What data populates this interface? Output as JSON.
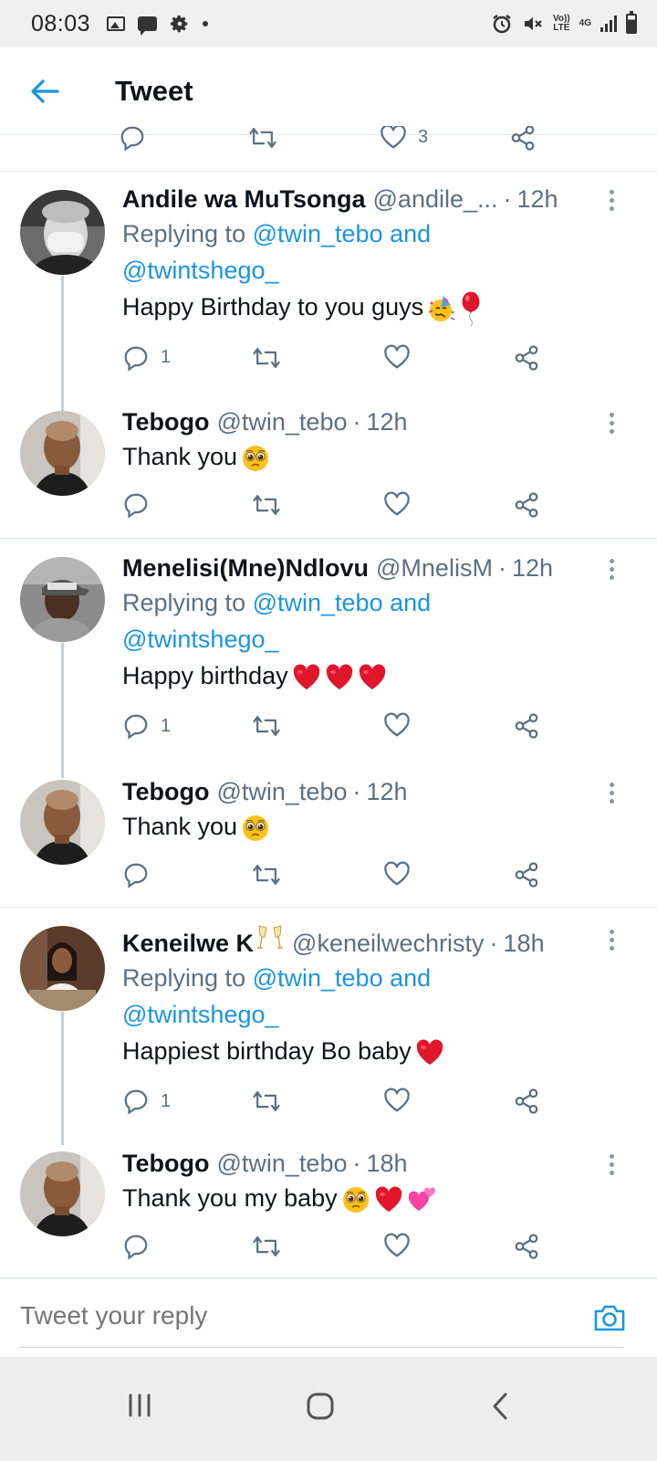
{
  "status_bar": {
    "time": "08:03",
    "network": "4G",
    "volte": "Vo)) LTE"
  },
  "header": {
    "title": "Tweet"
  },
  "top_tweet": {
    "like_count": "3"
  },
  "tweets": [
    {
      "name": "Andile wa MuTsonga",
      "handle": "@andile_...",
      "time": "12h",
      "replying_prefix": "Replying to ",
      "replying_to_1": "@twin_tebo and",
      "replying_to_2": "@twintshego_",
      "text": "Happy Birthday to you guys",
      "emojis": [
        "partying-face",
        "balloon"
      ],
      "reply_count": "1"
    },
    {
      "name": "Tebogo",
      "handle": "@twin_tebo",
      "time": "12h",
      "text": "Thank you",
      "emojis": [
        "pleading-face"
      ],
      "reply_count": ""
    },
    {
      "name": "Menelisi(Mne)Ndlovu",
      "handle": "@MnelisM",
      "time": "12h",
      "replying_prefix": "Replying to ",
      "replying_to_1": "@twin_tebo and",
      "replying_to_2": "@twintshego_",
      "text": "Happy birthday",
      "emojis": [
        "red-heart",
        "red-heart",
        "red-heart"
      ],
      "reply_count": "1"
    },
    {
      "name": "Tebogo",
      "handle": "@twin_tebo",
      "time": "12h",
      "text": "Thank you",
      "emojis": [
        "pleading-face"
      ],
      "reply_count": ""
    },
    {
      "name": "Keneilwe K",
      "handle": "@keneilwechristy",
      "time": "18h",
      "replying_prefix": "Replying to ",
      "replying_to_1": "@twin_tebo and",
      "replying_to_2": "@twintshego_",
      "text": "Happiest birthday Bo baby",
      "emojis": [
        "red-heart"
      ],
      "reply_count": "1"
    },
    {
      "name": "Tebogo",
      "handle": "@twin_tebo",
      "time": "18h",
      "text": "Thank you my baby",
      "emojis": [
        "pleading-face",
        "red-heart",
        "two-hearts"
      ],
      "reply_count": ""
    }
  ],
  "composer": {
    "placeholder": "Tweet your reply"
  },
  "colors": {
    "accent": "#1b95e0",
    "text_primary": "#0f1419",
    "text_secondary": "#5b7083",
    "icon": "#5b7083"
  }
}
